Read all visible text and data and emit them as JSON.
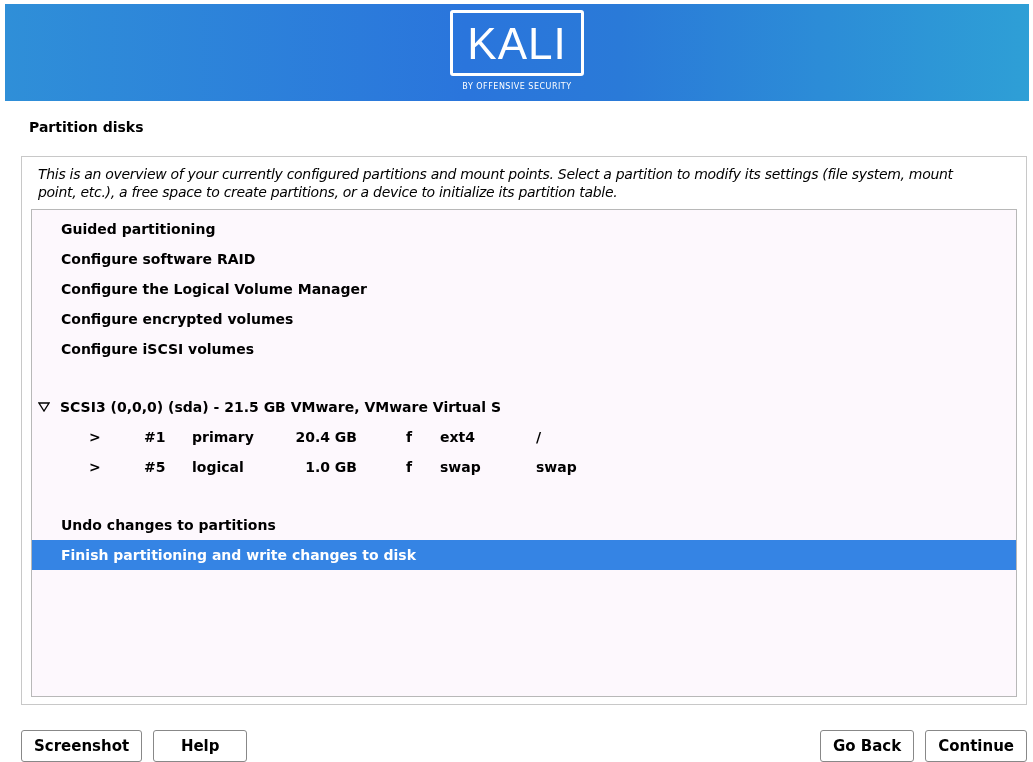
{
  "banner": {
    "logo_text": "KALI",
    "logo_subtitle": "BY OFFENSIVE SECURITY"
  },
  "title": "Partition disks",
  "description": "This is an overview of your currently configured partitions and mount points. Select a partition to modify its settings (file system, mount point, etc.), a free space to create partitions, or a device to initialize its partition table.",
  "groups": [
    {
      "items": [
        {
          "kind": "action",
          "label": "Guided partitioning",
          "selected": false
        },
        {
          "kind": "action",
          "label": "Configure software RAID",
          "selected": false
        },
        {
          "kind": "action",
          "label": "Configure the Logical Volume Manager",
          "selected": false
        },
        {
          "kind": "action",
          "label": "Configure encrypted volumes",
          "selected": false
        },
        {
          "kind": "action",
          "label": "Configure iSCSI volumes",
          "selected": false
        }
      ]
    },
    {
      "items": [
        {
          "kind": "disk",
          "label": "SCSI3 (0,0,0) (sda) - 21.5 GB VMware, VMware Virtual S",
          "selected": false,
          "expanded": true,
          "children": [
            {
              "arrow": ">",
              "number": "#1",
              "type": "primary",
              "size": "20.4 GB",
              "flag": "f",
              "filesystem": "ext4",
              "mount": "/",
              "selected": false
            },
            {
              "arrow": ">",
              "number": "#5",
              "type": "logical",
              "size": "1.0 GB",
              "flag": "f",
              "filesystem": "swap",
              "mount": "swap",
              "selected": false
            }
          ]
        }
      ]
    },
    {
      "items": [
        {
          "kind": "action",
          "label": "Undo changes to partitions",
          "selected": false
        },
        {
          "kind": "action",
          "label": "Finish partitioning and write changes to disk",
          "selected": true
        }
      ]
    }
  ],
  "buttons_left": [
    "Screenshot",
    "Help"
  ],
  "buttons_right": [
    "Go Back",
    "Continue"
  ]
}
